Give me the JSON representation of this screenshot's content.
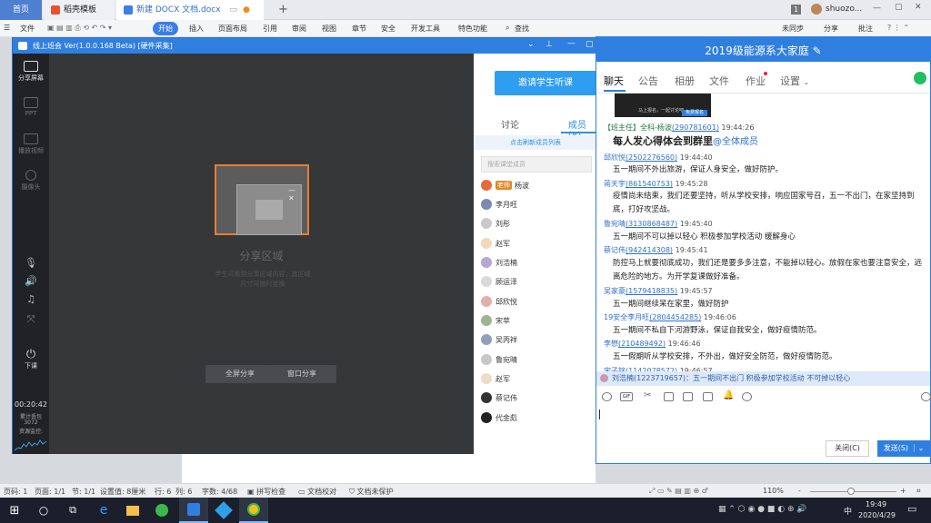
{
  "wps": {
    "tabs": [
      {
        "label": "首页"
      },
      {
        "label": "稻壳模板"
      },
      {
        "label": "新建 DOCX 文档.docx"
      }
    ],
    "tab_add": "+",
    "window_number": "1",
    "user_name": "shuozo...",
    "menu": [
      "文件",
      "开始",
      "插入",
      "页面布局",
      "引用",
      "审阅",
      "视图",
      "章节",
      "安全",
      "开发工具",
      "特色功能",
      "查找"
    ],
    "right_menu": [
      "未同步",
      "分享",
      "批注"
    ],
    "status": [
      "页码: 1",
      "页面: 1/1",
      "节: 1/1",
      "设置值: 8厘米",
      "行: 6",
      "列: 6",
      "字数: 4/68",
      "拼写检查",
      "文档校对",
      "文档未保护"
    ],
    "zoom": "110%",
    "zoom_minus": "-",
    "zoom_plus": "+"
  },
  "classroom": {
    "title": "线上班会 Ver(1.0.0.168 Beta) [硬件采集]",
    "left_tools": [
      {
        "label": "分享屏幕",
        "icon": "share-screen-icon"
      },
      {
        "label": "PPT",
        "icon": "ppt-icon"
      },
      {
        "label": "播放视频",
        "icon": "video-icon"
      },
      {
        "label": "摄像头",
        "icon": "camera-icon"
      }
    ],
    "exit_label": "下课",
    "timer": "00:20:42",
    "upload_label": "累计丢包",
    "upload_value": "3072",
    "resource_label": "资源监控:",
    "share_title": "分享区域",
    "share_hint": "学生可看到分享区域内容，其区域尺寸可随时变换",
    "btn_fullscreen": "全屏分享",
    "btn_window": "窗口分享",
    "invite": "邀请学生听课",
    "tab_discuss": "讨论",
    "tab_members": "成员(8)",
    "refresh": "点击刷新成员列表",
    "search_placeholder": "搜索课堂成员",
    "teacher_tag": "老师",
    "members": [
      "杨波",
      "李月旺",
      "刘彤",
      "赵军",
      "刘浩楠",
      "顾运泽",
      "邱欣悦",
      "宋苹",
      "吴丙祥",
      "鲁宛晴",
      "赵军",
      "蔡记伟",
      "代金彪"
    ]
  },
  "chat": {
    "title": "2019级能源系大家庭",
    "tabs": [
      "聊天",
      "公告",
      "相册",
      "文件",
      "作业",
      "设置"
    ],
    "thumb_text": "马上报名，一起讨论吧",
    "thumb_btn": "免费报名",
    "messages": [
      {
        "sender": "【班主任】全科-杨波",
        "qq": "(290781601)",
        "time": "19:44:26",
        "text": "每人发心得体会到群里",
        "mention": "@全体成员"
      },
      {
        "sender": "邱欣悦",
        "qq": "(2502276560)",
        "time": "19:44:40",
        "text": "五一期间不外出旅游，保证人身安全，做好防护。"
      },
      {
        "sender": "蒋天宇",
        "qq": "(861540753)",
        "time": "19:45:28",
        "text": "疫情尚未结束，我们还要坚持，听从学校安排，响应国家号召，五一不出门，在家坚持到底，打好攻坚战。"
      },
      {
        "sender": "鲁宛晴",
        "qq": "(3130868487)",
        "time": "19:45:40",
        "text": "五一期间不可以掉以轻心  积极参加学校活动  缓解身心"
      },
      {
        "sender": "蔡记伟",
        "qq": "(942414308)",
        "time": "19:45:41",
        "text": "防控马上就要彻底成功，我们还是要多多注意，不能掉以轻心。放假在家也要注意安全，远离危险的地方。为开学复课做好准备。"
      },
      {
        "sender": "吴家豪",
        "qq": "(1579418835)",
        "time": "19:45:57",
        "text": "五一期间继续呆在家里，做好防护"
      },
      {
        "sender": "19安全李月旺",
        "qq": "(2804454285)",
        "time": "19:46:06",
        "text": "五一期间不私自下河游野泳，保证自我安全，做好疫情防范。"
      },
      {
        "sender": "李懋",
        "qq": "(210489492)",
        "time": "19:46:46",
        "text": "五一假期听从学校安排，不外出，做好安全防范，做好疫情防范。"
      },
      {
        "sender": "宋子铭",
        "qq": "(1142078572)",
        "time": "19:46:57",
        "text": ""
      }
    ],
    "notice": "刘浩楠(1223719657)：五一期间不出门  积极参加学校活动  不可掉以轻心",
    "close_btn": "关闭(C)",
    "send_btn": "发送(S)"
  },
  "taskbar": {
    "time": "19:49",
    "date": "2020/4/29",
    "ime": "中"
  }
}
